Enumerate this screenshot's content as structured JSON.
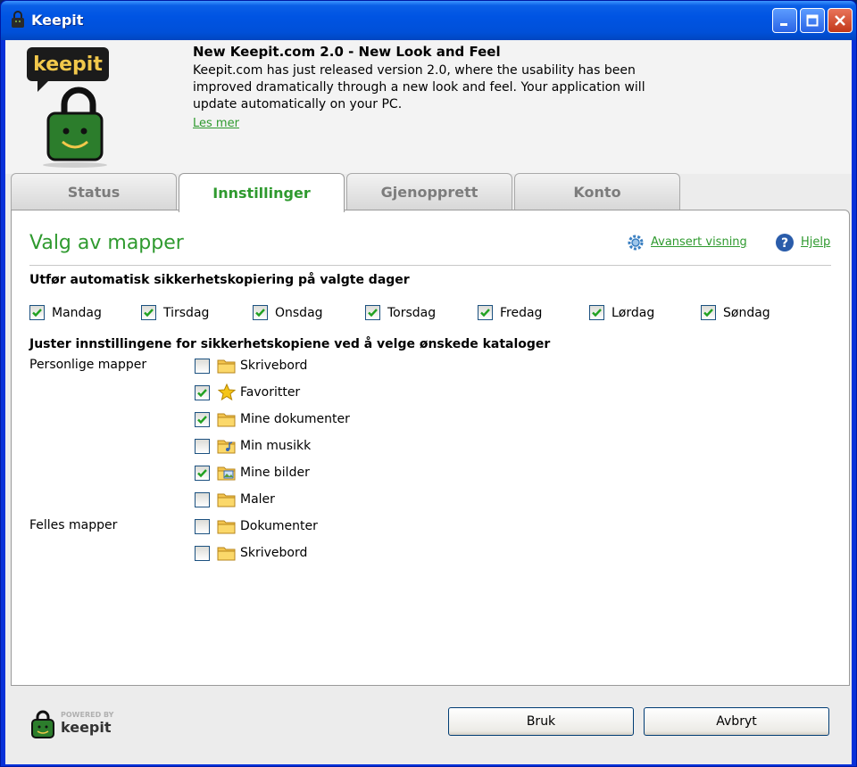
{
  "window": {
    "title": "Keepit"
  },
  "banner": {
    "news_title": "New Keepit.com 2.0 - New Look and Feel",
    "news_body": "Keepit.com has just released version 2.0, where the usability has been improved dramatically through a new look and feel. Your application will update automatically on your PC.",
    "read_more": "Les mer",
    "logo_text": "keepit"
  },
  "tabs": [
    {
      "label": "Status",
      "active": false
    },
    {
      "label": "Innstillinger",
      "active": true
    },
    {
      "label": "Gjenopprett",
      "active": false
    },
    {
      "label": "Konto",
      "active": false
    }
  ],
  "panel": {
    "title": "Valg av mapper",
    "advanced_link": "Avansert visning",
    "help_link": "Hjelp",
    "days_heading": "Utfør automatisk sikkerhetskopiering på valgte dager",
    "days": [
      {
        "label": "Mandag",
        "checked": true
      },
      {
        "label": "Tirsdag",
        "checked": true
      },
      {
        "label": "Onsdag",
        "checked": true
      },
      {
        "label": "Torsdag",
        "checked": true
      },
      {
        "label": "Fredag",
        "checked": true
      },
      {
        "label": "Lørdag",
        "checked": true
      },
      {
        "label": "Søndag",
        "checked": true
      }
    ],
    "folders_heading": "Juster innstillingene for sikkerhetskopiene ved å velge ønskede kataloger",
    "groups": [
      {
        "label": "Personlige mapper",
        "items": [
          {
            "label": "Skrivebord",
            "checked": false,
            "icon": "folder-icon"
          },
          {
            "label": "Favoritter",
            "checked": true,
            "icon": "star-icon"
          },
          {
            "label": "Mine dokumenter",
            "checked": true,
            "icon": "folder-icon"
          },
          {
            "label": "Min musikk",
            "checked": false,
            "icon": "music-folder-icon"
          },
          {
            "label": "Mine bilder",
            "checked": true,
            "icon": "pictures-folder-icon"
          },
          {
            "label": "Maler",
            "checked": false,
            "icon": "folder-icon"
          }
        ]
      },
      {
        "label": "Felles mapper",
        "items": [
          {
            "label": "Dokumenter",
            "checked": false,
            "icon": "folder-icon"
          },
          {
            "label": "Skrivebord",
            "checked": false,
            "icon": "folder-icon"
          }
        ]
      }
    ]
  },
  "footer": {
    "powered_by": "POWERED BY",
    "brand": "keepit",
    "apply_label": "Bruk",
    "cancel_label": "Avbryt"
  },
  "colors": {
    "accent_green": "#2f9a2f",
    "title_bar": "#0054e3",
    "checkbox_border": "#1c5180"
  }
}
